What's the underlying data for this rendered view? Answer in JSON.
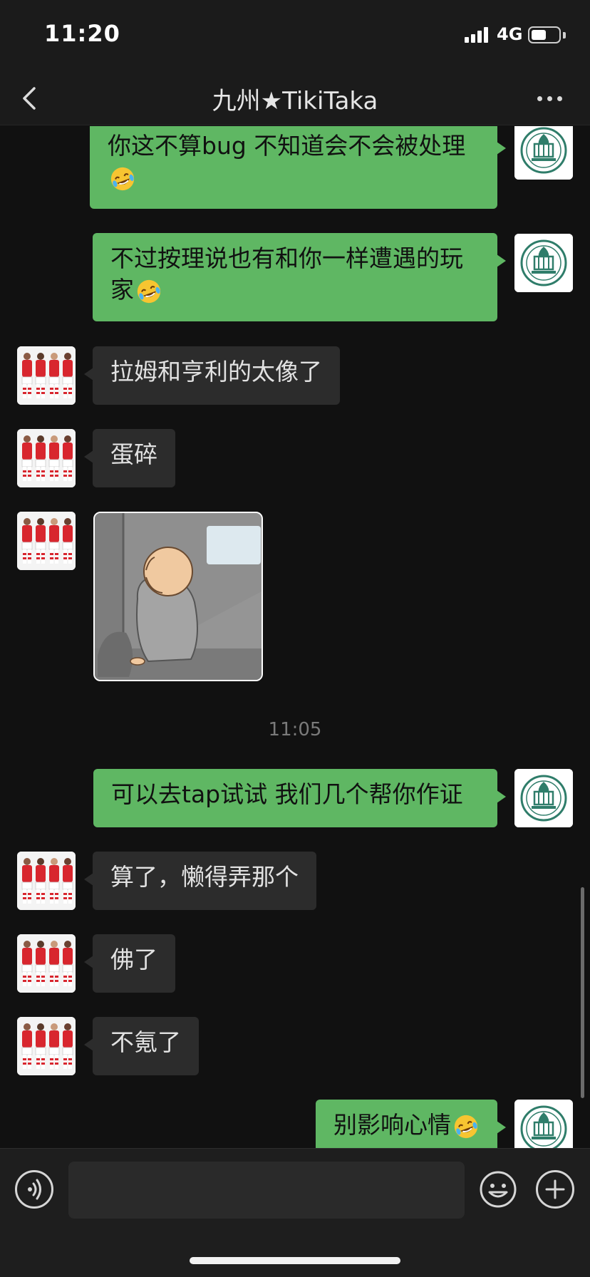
{
  "status_bar": {
    "time": "11:20",
    "network": "4G",
    "battery_level": 0.55
  },
  "header": {
    "title": "九州★TikiTaka"
  },
  "messages": [
    {
      "from": "me",
      "text": "你这不算bug 不知道会不会被处理",
      "emoji": "rofl-emoji"
    },
    {
      "from": "me",
      "text": "不过按理说也有和你一样遭遇的玩家",
      "emoji": "rofl-emoji"
    },
    {
      "from": "other",
      "text": "拉姆和亨利的太像了"
    },
    {
      "from": "other",
      "text": "蛋碎"
    },
    {
      "from": "other",
      "sticker": "sad-cartoon-sticker"
    },
    {
      "time_separator": "11:05"
    },
    {
      "from": "me",
      "text": "可以去tap试试 我们几个帮你作证"
    },
    {
      "from": "other",
      "text": "算了，懒得弄那个"
    },
    {
      "from": "other",
      "text": "佛了"
    },
    {
      "from": "other",
      "text": "不氪了"
    },
    {
      "from": "me",
      "text": "别影响心情",
      "emoji": "rofl-emoji"
    }
  ],
  "colors": {
    "sent_bubble": "#5fb763",
    "received_bubble": "#2c2c2c",
    "background": "#111111"
  },
  "input_bar": {
    "value": "",
    "voice_icon": "voice-icon",
    "emoji_icon": "smiley-icon",
    "plus_icon": "plus-icon"
  }
}
